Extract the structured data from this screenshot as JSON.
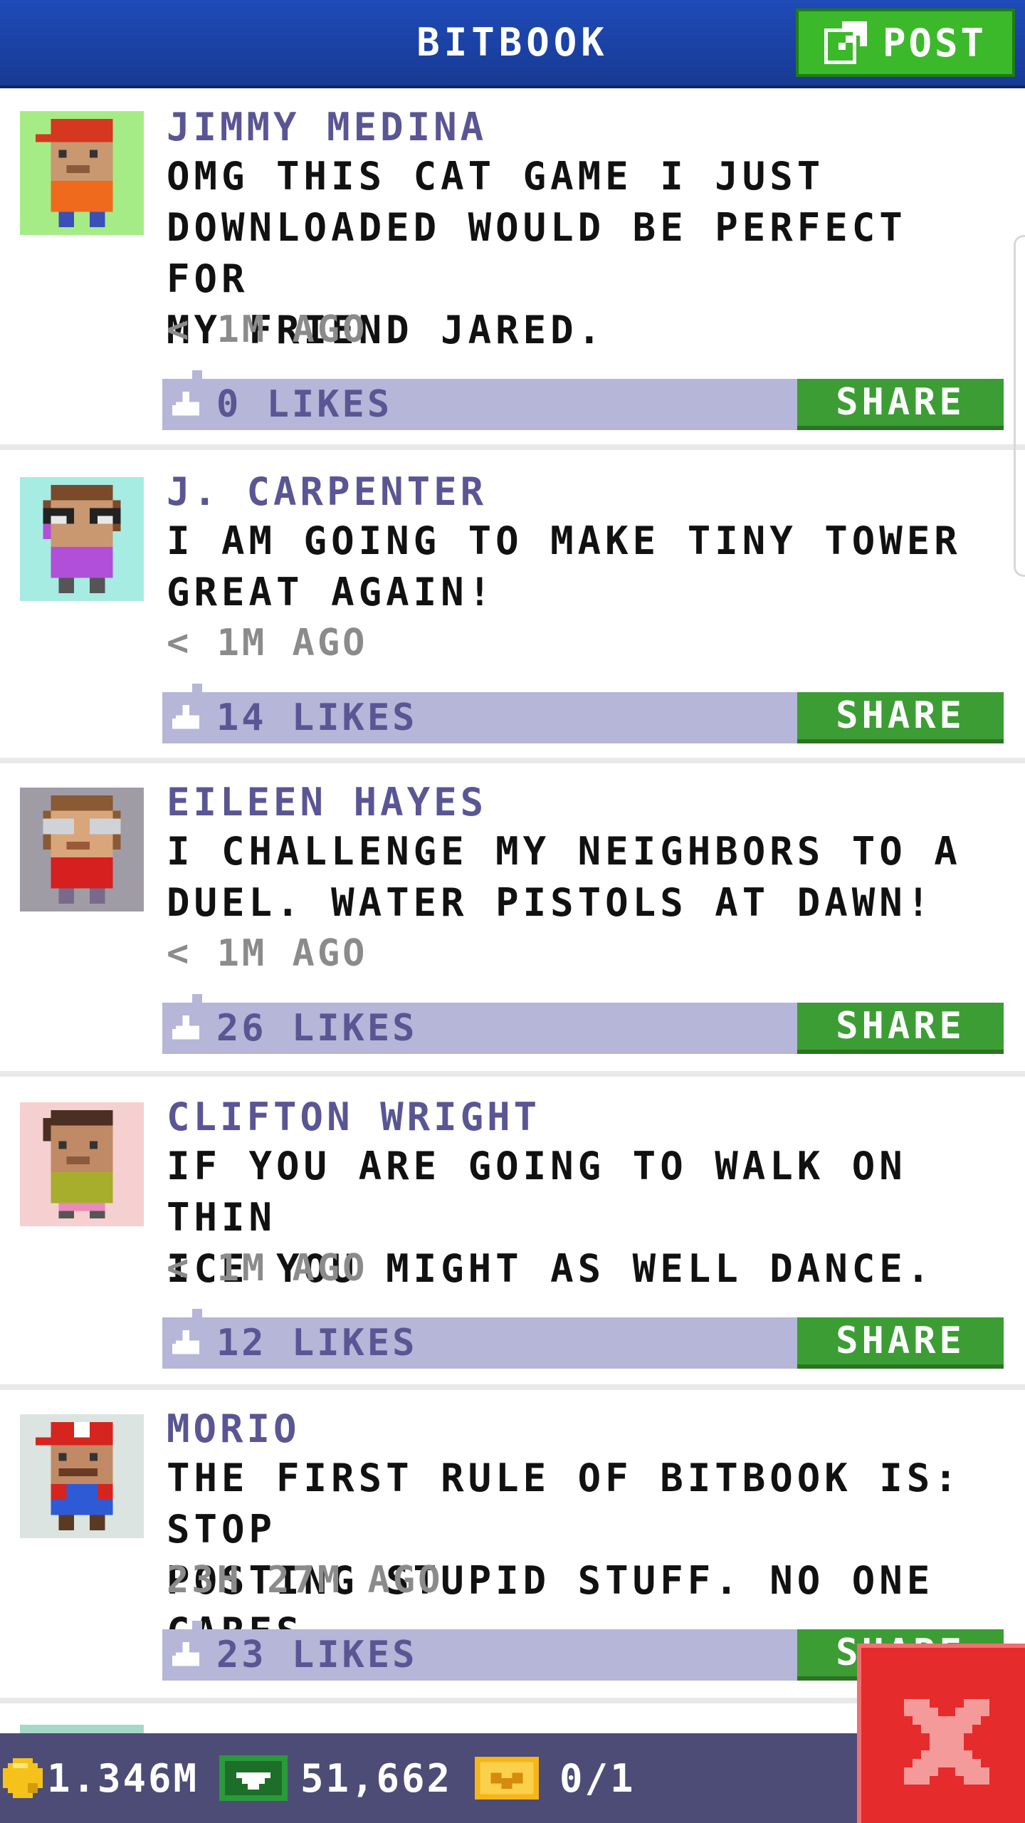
{
  "header": {
    "title": "BITBOOK",
    "post_label": "POST",
    "post_icon": "edit-icon"
  },
  "posts": [
    {
      "author": "JIMMY MEDINA",
      "message": "OMG THIS CAT GAME I JUST\nDOWNLOADED WOULD BE PERFECT FOR\nMY FRIEND JARED.",
      "time": "< 1M AGO",
      "likes": "0 LIKES",
      "share": "SHARE"
    },
    {
      "author": "J. CARPENTER",
      "message": "I AM GOING TO MAKE TINY TOWER\nGREAT AGAIN!",
      "time": "< 1M AGO",
      "likes": "14 LIKES",
      "share": "SHARE"
    },
    {
      "author": "EILEEN HAYES",
      "message": "I CHALLENGE MY NEIGHBORS TO A\nDUEL. WATER PISTOLS AT DAWN!",
      "time": "< 1M AGO",
      "likes": "26 LIKES",
      "share": "SHARE"
    },
    {
      "author": "CLIFTON WRIGHT",
      "message": "IF YOU ARE GOING TO WALK ON THIN\nICE YOU MIGHT AS WELL DANCE.",
      "time": "< 1M AGO",
      "likes": "12 LIKES",
      "share": "SHARE"
    },
    {
      "author": "MORIO",
      "message": "THE FIRST RULE OF BITBOOK IS: STOP\nPOSTING STUPID STUFF. NO ONE CARES.",
      "time": "23H 27M AGO",
      "likes": "23 LIKES",
      "share": "SHARE"
    }
  ],
  "colors": {
    "header": "#1f4bb8",
    "author": "#5a5694",
    "likes_bar": "#b5b6d8",
    "share": "#3c9d34",
    "bottom_bar": "#4d4c76",
    "close": "#e52b2b"
  },
  "bottom_bar": {
    "coins": "1.346M",
    "coins_icon": "coin-icon",
    "bux": "51,662",
    "bux_icon": "bux-icon",
    "tickets": "0/1",
    "tickets_icon": "ticket-icon",
    "close_icon": "close-icon"
  }
}
